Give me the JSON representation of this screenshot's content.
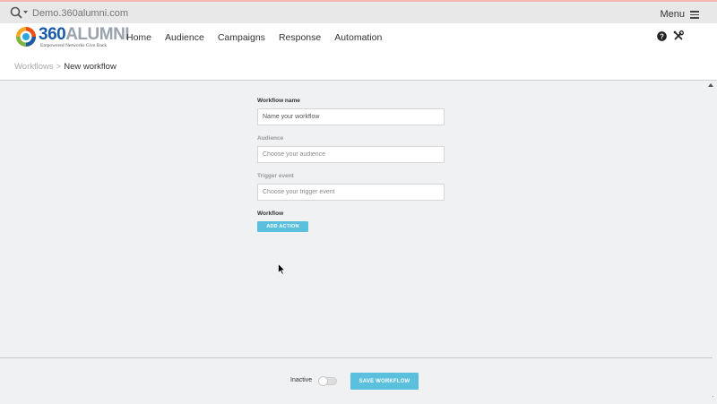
{
  "topbar": {
    "search_icon": "search-icon",
    "domain_placeholder": "Demo.360alumni.com",
    "menu_label": "Menu",
    "menu_icon": "hamburger-icon"
  },
  "header": {
    "logo_number": "360",
    "logo_word": "ALUMNI",
    "logo_tagline": "Empowered Networks Give Back",
    "nav": [
      "Home",
      "Audience",
      "Campaigns",
      "Response",
      "Automation"
    ],
    "help_icon": "question-circle-icon",
    "tools_icon": "wrench-screwdriver-icon"
  },
  "breadcrumb": {
    "parent": "Workflows",
    "separator": ">",
    "current": "New workflow"
  },
  "form": {
    "workflow_name_label": "Workflow name",
    "workflow_name_placeholder": "Name your workflow",
    "audience_label": "Audience",
    "audience_placeholder": "Choose your audience",
    "trigger_label": "Trigger event",
    "trigger_placeholder": "Choose your trigger event",
    "workflow_label": "Workflow",
    "add_action_label": "ADD ACTION"
  },
  "footer": {
    "status_label": "Inactive",
    "toggle_on": false,
    "save_label": "SAVE WORKFLOW"
  },
  "colors": {
    "accent": "#5bc0de",
    "brand_blue": "#1a5aa8",
    "background": "#f0f1f3"
  }
}
